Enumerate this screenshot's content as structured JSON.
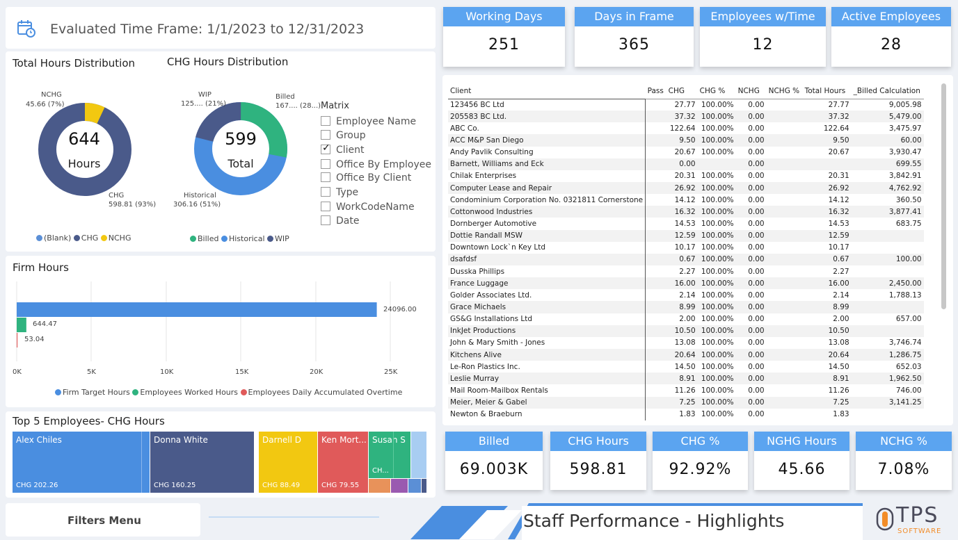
{
  "header": {
    "title": "Evaluated Time Frame: 1/1/2023 to 12/31/2023",
    "icon": "calendar-clock-icon"
  },
  "kpis_top": [
    {
      "label": "Working Days",
      "value": "251"
    },
    {
      "label": "Days in Frame",
      "value": "365"
    },
    {
      "label": "Employees w/Time",
      "value": "12"
    },
    {
      "label": "Active Employees",
      "value": "28"
    }
  ],
  "total_hours": {
    "title": "Total Hours Distribution",
    "center_value": "644",
    "center_label": "Hours",
    "label_nchg": "NCHG",
    "label_nchg_val": "45.66 (7%)",
    "label_chg": "CHG",
    "label_chg_val": "598.81 (93%)",
    "legend": [
      "(Blank)",
      "CHG",
      "NCHG"
    ],
    "colors": [
      "#5b8fd6",
      "#4a5a8a",
      "#f2c811"
    ]
  },
  "chg_hours": {
    "title": "CHG Hours Distribution",
    "center_value": "599",
    "center_label": "Total",
    "label_wip": "WIP",
    "label_wip_val": "125.... (21%)",
    "label_billed": "Billed",
    "label_billed_val": "167.... (28...)",
    "label_hist": "Historical",
    "label_hist_val": "306.16 (51%)",
    "legend": [
      "Billed",
      "Historical",
      "WIP"
    ],
    "colors": [
      "#2fb37f",
      "#4a8ee0",
      "#4a5a8a"
    ]
  },
  "matrix": {
    "title": "Matrix",
    "options": [
      {
        "label": "Employee Name",
        "checked": false
      },
      {
        "label": "Group",
        "checked": false
      },
      {
        "label": "Client",
        "checked": true
      },
      {
        "label": "Office By Employee",
        "checked": false
      },
      {
        "label": "Office By Client",
        "checked": false
      },
      {
        "label": "Type",
        "checked": false
      },
      {
        "label": "WorkCodeName",
        "checked": false
      },
      {
        "label": "Date",
        "checked": false
      }
    ]
  },
  "firm_hours": {
    "title": "Firm Hours",
    "bars": [
      {
        "label": "24096.00",
        "value": 24096,
        "color": "#4a8ee0"
      },
      {
        "label": "644.47",
        "value": 644.47,
        "color": "#2fb37f"
      },
      {
        "label": "53.04",
        "value": 53.04,
        "color": "#e05a5a"
      }
    ],
    "ticks": [
      "0K",
      "5K",
      "10K",
      "15K",
      "20K",
      "25K"
    ],
    "legend": [
      "Firm Target Hours",
      "Employees Worked Hours",
      "Employees Daily Accumulated Overtime"
    ]
  },
  "top5": {
    "title": "Top 5 Employees- CHG Hours",
    "tiles": [
      {
        "name": "Alex Chiles",
        "value": "CHG 202.26",
        "color": "#4a8ee0"
      },
      {
        "name": "Donna White",
        "value": "CHG 160.25",
        "color": "#4a5a8a"
      },
      {
        "name": "Darnell D",
        "value": "CHG 88.49",
        "color": "#f2c811"
      },
      {
        "name": "Ken Mort...",
        "value": "CHG 79.55",
        "color": "#e05a5a"
      },
      {
        "name": "Susan S",
        "value": "CH...",
        "color": "#2fb37f"
      }
    ]
  },
  "table": {
    "headers": [
      "Client",
      "Pass",
      "CHG",
      "CHG %",
      "NCHG",
      "NCHG %",
      "Total Hours",
      "_Billed Calculation"
    ],
    "rows": [
      [
        "123456 BC Ltd",
        "",
        "27.77",
        "100.00%",
        "0.00",
        "",
        "27.77",
        "9,005.98"
      ],
      [
        "205583 BC Ltd.",
        "",
        "37.32",
        "100.00%",
        "0.00",
        "",
        "37.32",
        "5,479.00"
      ],
      [
        "ABC Co.",
        "",
        "122.64",
        "100.00%",
        "0.00",
        "",
        "122.64",
        "3,475.97"
      ],
      [
        "ACC M&P San Diego",
        "",
        "9.50",
        "100.00%",
        "0.00",
        "",
        "9.50",
        "60.00"
      ],
      [
        "Andy Pavlik Consulting",
        "",
        "20.67",
        "100.00%",
        "0.00",
        "",
        "20.67",
        "3,930.47"
      ],
      [
        "Barnett, Williams and Eck",
        "",
        "0.00",
        "",
        "0.00",
        "",
        "",
        "699.55"
      ],
      [
        "Chilak Enterprises",
        "",
        "20.31",
        "100.00%",
        "0.00",
        "",
        "20.31",
        "3,842.91"
      ],
      [
        "Computer Lease and Repair",
        "",
        "26.92",
        "100.00%",
        "0.00",
        "",
        "26.92",
        "4,762.92"
      ],
      [
        "Condominium Corporation No. 0321811 Cornerstone",
        "",
        "14.12",
        "100.00%",
        "0.00",
        "",
        "14.12",
        "360.50"
      ],
      [
        "Cottonwood Industries",
        "",
        "16.32",
        "100.00%",
        "0.00",
        "",
        "16.32",
        "3,877.41"
      ],
      [
        "Dornberger Automotive",
        "",
        "14.53",
        "100.00%",
        "0.00",
        "",
        "14.53",
        "683.75"
      ],
      [
        "Dottie Randall MSW",
        "",
        "12.59",
        "100.00%",
        "0.00",
        "",
        "12.59",
        ""
      ],
      [
        "Downtown Lock`n Key Ltd",
        "",
        "10.17",
        "100.00%",
        "0.00",
        "",
        "10.17",
        ""
      ],
      [
        "dsafdsf",
        "",
        "0.67",
        "100.00%",
        "0.00",
        "",
        "0.67",
        "100.00"
      ],
      [
        "Dusska Phillips",
        "",
        "2.27",
        "100.00%",
        "0.00",
        "",
        "2.27",
        ""
      ],
      [
        "France Luggage",
        "",
        "16.00",
        "100.00%",
        "0.00",
        "",
        "16.00",
        "2,450.00"
      ],
      [
        "Golder Associates Ltd.",
        "",
        "2.14",
        "100.00%",
        "0.00",
        "",
        "2.14",
        "1,788.13"
      ],
      [
        "Grace Michaels",
        "",
        "8.99",
        "100.00%",
        "0.00",
        "",
        "8.99",
        ""
      ],
      [
        "GS&G Installations Ltd",
        "",
        "2.00",
        "100.00%",
        "0.00",
        "",
        "2.00",
        "657.00"
      ],
      [
        "InkJet Productions",
        "",
        "10.50",
        "100.00%",
        "0.00",
        "",
        "10.50",
        ""
      ],
      [
        "John & Mary Smith - Jones",
        "",
        "13.08",
        "100.00%",
        "0.00",
        "",
        "13.08",
        "3,746.74"
      ],
      [
        "Kitchens Alive",
        "",
        "20.64",
        "100.00%",
        "0.00",
        "",
        "20.64",
        "1,286.75"
      ],
      [
        "Le-Ron Plastics Inc.",
        "",
        "14.50",
        "100.00%",
        "0.00",
        "",
        "14.50",
        "652.03"
      ],
      [
        "Leslie Murray",
        "",
        "8.91",
        "100.00%",
        "0.00",
        "",
        "8.91",
        "1,962.50"
      ],
      [
        "Mail Room-Mailbox Rentals",
        "",
        "11.26",
        "100.00%",
        "0.00",
        "",
        "11.26",
        "746.00"
      ],
      [
        "Meier, Meier & Gabel",
        "",
        "7.25",
        "100.00%",
        "0.00",
        "",
        "7.25",
        "3,141.25"
      ],
      [
        "Newton & Braeburn",
        "",
        "1.83",
        "100.00%",
        "0.00",
        "",
        "1.83",
        ""
      ]
    ]
  },
  "kpis_bottom": [
    {
      "label": "Billed",
      "value": "69.003K"
    },
    {
      "label": "CHG Hours",
      "value": "598.81"
    },
    {
      "label": "CHG %",
      "value": "92.92%"
    },
    {
      "label": "NGHG Hours",
      "value": "45.66"
    },
    {
      "label": "NCHG %",
      "value": "7.08%"
    }
  ],
  "footer": {
    "filters_label": "Filters Menu",
    "page_title": "Staff Performance - Highlights",
    "logo_text": "TPS",
    "logo_sub": "SOFTWARE"
  }
}
